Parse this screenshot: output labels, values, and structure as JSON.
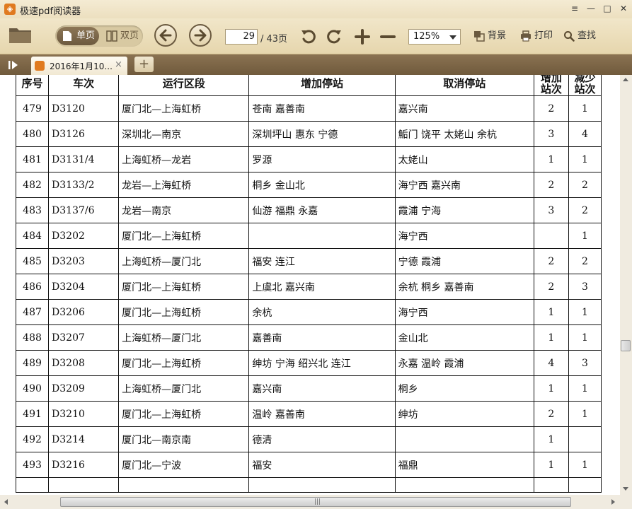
{
  "window": {
    "title": "极速pdf阅读器",
    "logo_glyph": "◈",
    "controls": {
      "menu": "≡",
      "minimize": "—",
      "maximize": "□",
      "close": "✕"
    }
  },
  "toolbar": {
    "single_page": "单页",
    "double_page": "双页",
    "current_page": "29",
    "total_pages": "/ 43页",
    "zoom": "125%",
    "background": "背景",
    "print": "打印",
    "search": "查找"
  },
  "tabs": [
    {
      "label": "2016年1月10...",
      "close": "×"
    }
  ],
  "new_tab": "+",
  "scroll": {
    "grip": "|||"
  },
  "table": {
    "headers": [
      "序号",
      "车次",
      "运行区段",
      "增加停站",
      "取消停站",
      "增加站次",
      "减少站次"
    ],
    "rows": [
      [
        "479",
        "D3120",
        "厦门北—上海虹桥",
        "苍南 嘉善南",
        "嘉兴南",
        "2",
        "1"
      ],
      [
        "480",
        "D3126",
        "深圳北—南京",
        "深圳坪山  惠东  宁德",
        "鮜门 饶平 太姥山 余杭",
        "3",
        "4"
      ],
      [
        "481",
        "D3131/4",
        "上海虹桥—龙岩",
        "罗源",
        "太姥山",
        "1",
        "1"
      ],
      [
        "482",
        "D3133/2",
        "龙岩—上海虹桥",
        "桐乡 金山北",
        "海宁西 嘉兴南",
        "2",
        "2"
      ],
      [
        "483",
        "D3137/6",
        "龙岩—南京",
        "仙游 福鼎 永嘉",
        "霞浦 宁海",
        "3",
        "2"
      ],
      [
        "484",
        "D3202",
        "厦门北—上海虹桥",
        "",
        "海宁西",
        "",
        "1"
      ],
      [
        "485",
        "D3203",
        "上海虹桥—厦门北",
        "福安 连江",
        "宁德 霞浦",
        "2",
        "2"
      ],
      [
        "486",
        "D3204",
        "厦门北—上海虹桥",
        "上虞北 嘉兴南",
        "余杭 桐乡 嘉善南",
        "2",
        "3"
      ],
      [
        "487",
        "D3206",
        "厦门北—上海虹桥",
        "余杭",
        "海宁西",
        "1",
        "1"
      ],
      [
        "488",
        "D3207",
        "上海虹桥—厦门北",
        "嘉善南",
        "金山北",
        "1",
        "1"
      ],
      [
        "489",
        "D3208",
        "厦门北—上海虹桥",
        "绅坊 宁海 绍兴北 连江",
        "永嘉 温岭 霞浦",
        "4",
        "3"
      ],
      [
        "490",
        "D3209",
        "上海虹桥—厦门北",
        "嘉兴南",
        "桐乡",
        "1",
        "1"
      ],
      [
        "491",
        "D3210",
        "厦门北—上海虹桥",
        "温岭 嘉善南",
        "绅坊",
        "2",
        "1"
      ],
      [
        "492",
        "D3214",
        "厦门北—南京南",
        "德清",
        "",
        "1",
        ""
      ],
      [
        "493",
        "D3216",
        "厦门北—宁波",
        "福安",
        "福鼎",
        "1",
        "1"
      ]
    ]
  }
}
